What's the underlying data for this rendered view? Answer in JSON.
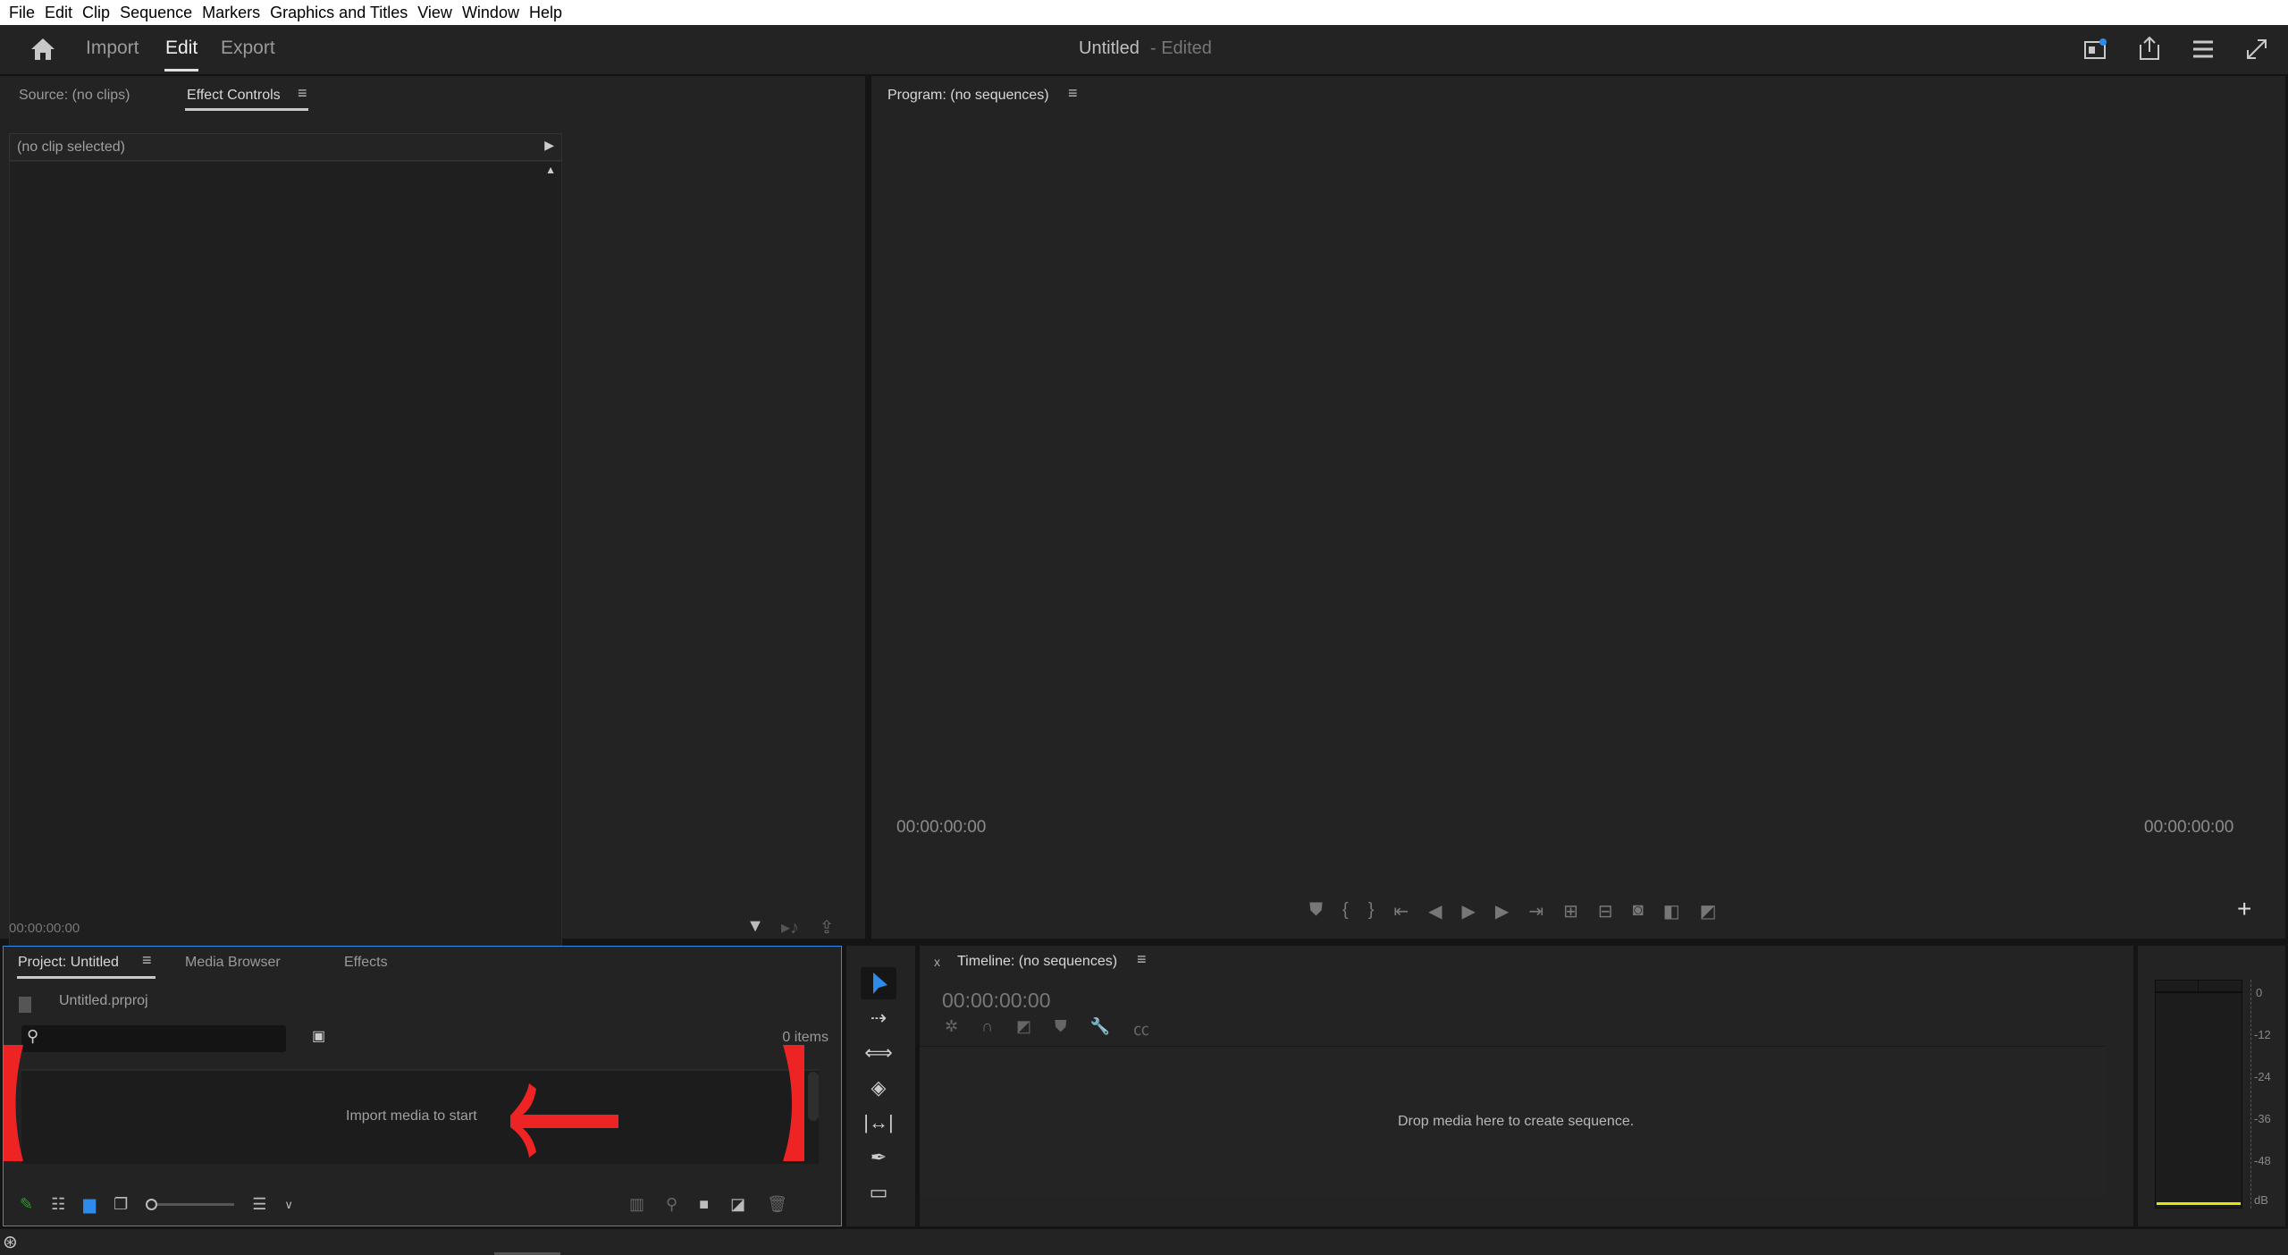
{
  "menu": [
    "File",
    "Edit",
    "Clip",
    "Sequence",
    "Markers",
    "Graphics and Titles",
    "View",
    "Window",
    "Help"
  ],
  "header": {
    "workspaces": [
      "Import",
      "Edit",
      "Export"
    ],
    "active": "Edit",
    "title": "Untitled",
    "title_status": "- Edited"
  },
  "source": {
    "tabs": [
      "Source: (no clips)",
      "Effect Controls"
    ],
    "active_tab": "Effect Controls",
    "clip_label": "(no clip selected)",
    "timecode": "00:00:00:00"
  },
  "program": {
    "title": "Program: (no sequences)",
    "timecode_left": "00:00:00:00",
    "timecode_right": "00:00:00:00"
  },
  "project": {
    "tabs": [
      "Project: Untitled",
      "Media Browser",
      "Effects"
    ],
    "active_tab": "Project: Untitled",
    "file": "Untitled.prproj",
    "search_placeholder": "",
    "items_count": "0 items",
    "empty_message": "Import media to start"
  },
  "timeline": {
    "title": "Timeline: (no sequences)",
    "close": "x",
    "timecode": "00:00:00:00",
    "drop_message": "Drop media here to create sequence."
  },
  "meter": {
    "ticks": [
      "0",
      "-12",
      "-24",
      "-36",
      "-48",
      "dB"
    ]
  },
  "colors": {
    "accent": "#2d8ceb",
    "annotation": "#ee2424",
    "meter_level": "#e6e600"
  }
}
